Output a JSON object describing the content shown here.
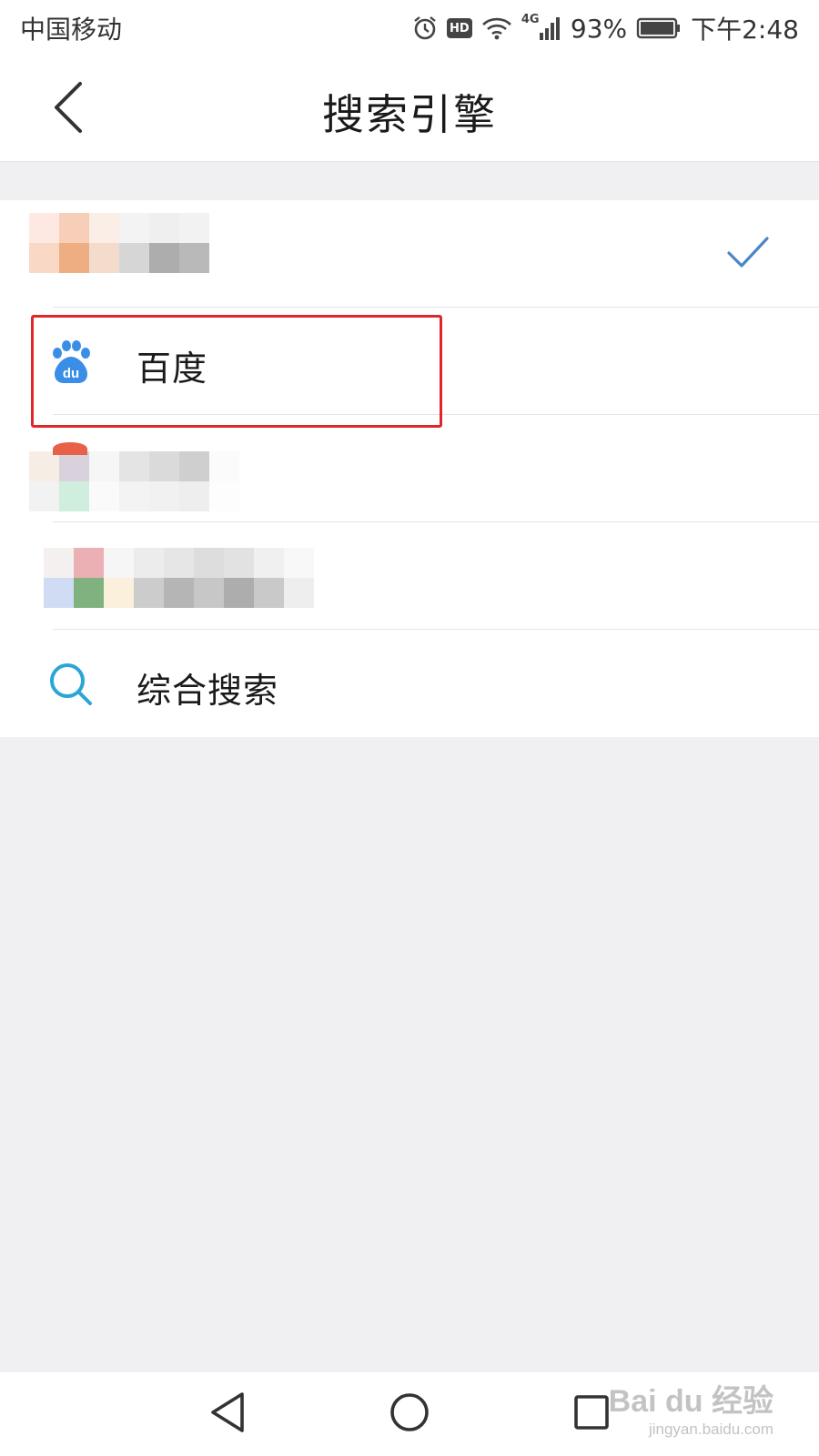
{
  "status_bar": {
    "carrier": "中国移动",
    "network": "4G",
    "battery": "93%",
    "time": "下午2:48",
    "icons": [
      "alarm-icon",
      "hd-icon",
      "wifi-icon",
      "signal-icon",
      "battery-icon"
    ],
    "hd_label": "HD"
  },
  "header": {
    "title": "搜索引擎",
    "back_icon": "chevron-left-icon"
  },
  "engines": [
    {
      "label": "",
      "selected": true,
      "obscured": true,
      "icon": "engine-1-icon"
    },
    {
      "label": "百度",
      "selected": false,
      "obscured": false,
      "icon": "baidu-paw-icon",
      "icon_text": "du"
    },
    {
      "label": "",
      "selected": false,
      "obscured": true,
      "icon": "engine-3-icon"
    },
    {
      "label": "",
      "selected": false,
      "obscured": true,
      "icon": "engine-4-icon"
    },
    {
      "label": "综合搜索",
      "selected": false,
      "obscured": false,
      "icon": "search-icon"
    }
  ],
  "nav_bar": {
    "buttons": [
      "back-triangle-icon",
      "home-circle-icon",
      "recents-square-icon"
    ]
  },
  "watermark": {
    "main": "Bai du 经验",
    "sub": "jingyan.baidu.com"
  },
  "colors": {
    "accent_blue": "#3a8ee6",
    "check_blue": "#4a86c8",
    "highlight_red": "#e0262b",
    "search_icon": "#2aa6d6"
  }
}
